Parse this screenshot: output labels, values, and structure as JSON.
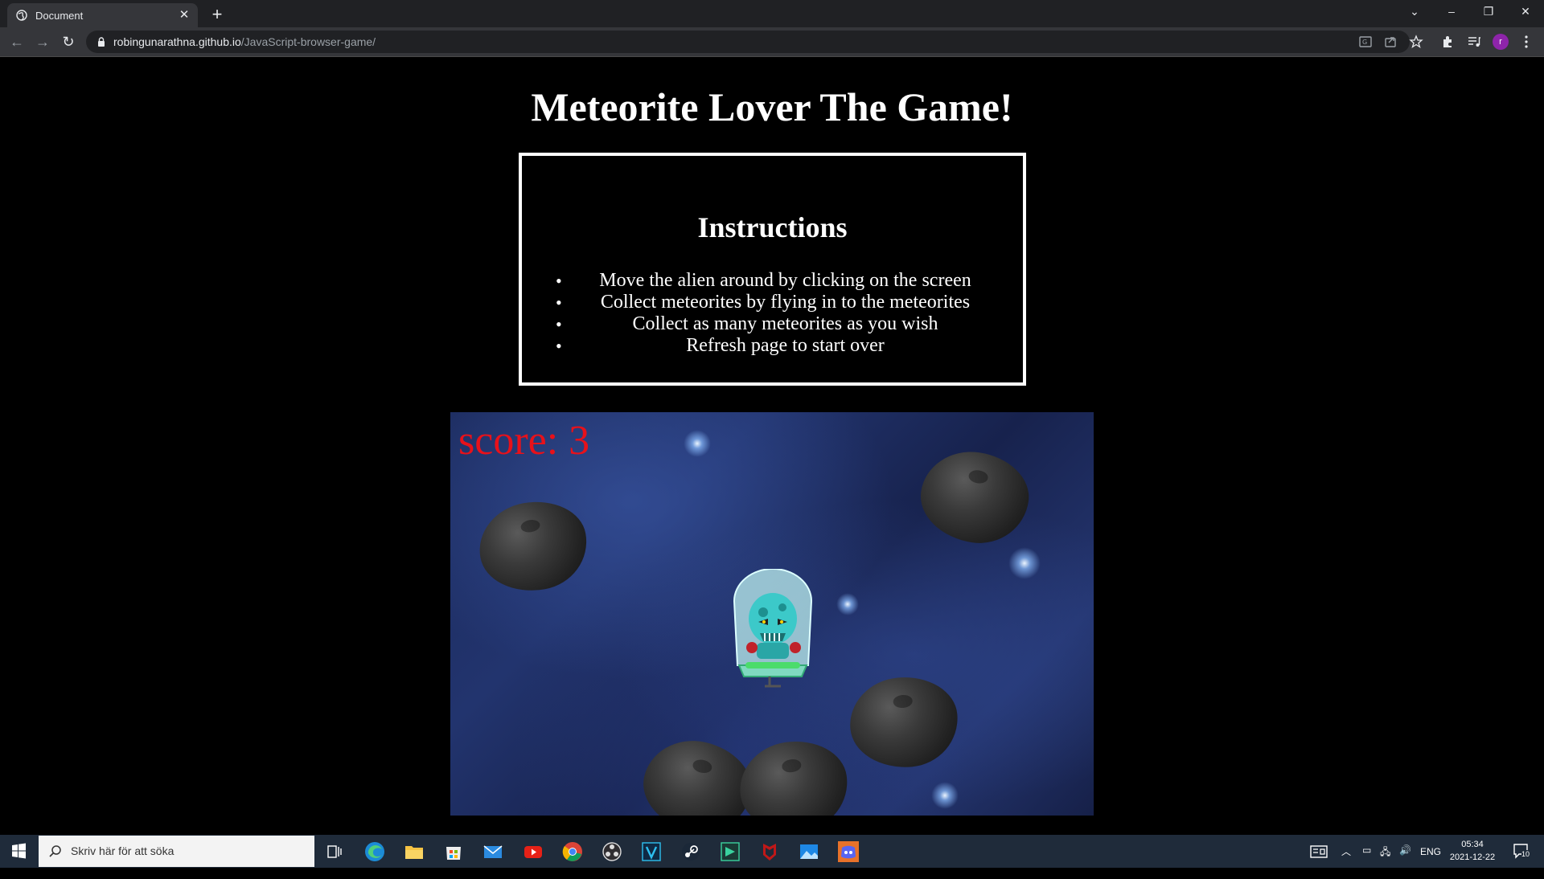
{
  "browser": {
    "tab_title": "Document",
    "tab_close": "✕",
    "new_tab": "+",
    "url_host": "robingunarathna.github.io",
    "url_path": "/JavaScript-browser-game/",
    "profile_initial": "r",
    "window_controls": {
      "minimize": "–",
      "restore": "❐",
      "close": "✕"
    },
    "icons": [
      "back-arrow-icon",
      "forward-arrow-icon",
      "reload-icon",
      "lock-icon",
      "translate-icon",
      "share-icon",
      "star-icon",
      "extensions-icon",
      "media-control-icon",
      "menu-icon"
    ]
  },
  "page": {
    "title": "Meteorite Lover The Game!",
    "instructions": {
      "heading": "Instructions",
      "items": [
        "Move the alien around by clicking on the screen",
        "Collect meteorites by flying in to the meteorites",
        "Collect as many meteorites as you wish",
        "Refresh page to start over"
      ]
    },
    "game": {
      "score_label": "score: 3",
      "background": "space-nebula",
      "sprites": [
        "alien-ship",
        "meteorite",
        "meteorite",
        "meteorite",
        "meteorite",
        "meteorite"
      ]
    }
  },
  "taskbar": {
    "search_placeholder": "Skriv här för att söka",
    "language": "ENG",
    "time": "05:34",
    "date": "2021-12-22",
    "notification_count": "10",
    "apps": [
      "task-view",
      "edge",
      "file-explorer",
      "store",
      "mail",
      "youtube",
      "chrome",
      "obs",
      "v-app",
      "steam",
      "vs-app",
      "mcafee",
      "photos",
      "discord"
    ]
  },
  "colors": {
    "score": "#e8111a",
    "page_bg": "#000000",
    "tabbar": "#202124",
    "toolbar": "#35363a",
    "taskbar": "#1f2b3a"
  }
}
